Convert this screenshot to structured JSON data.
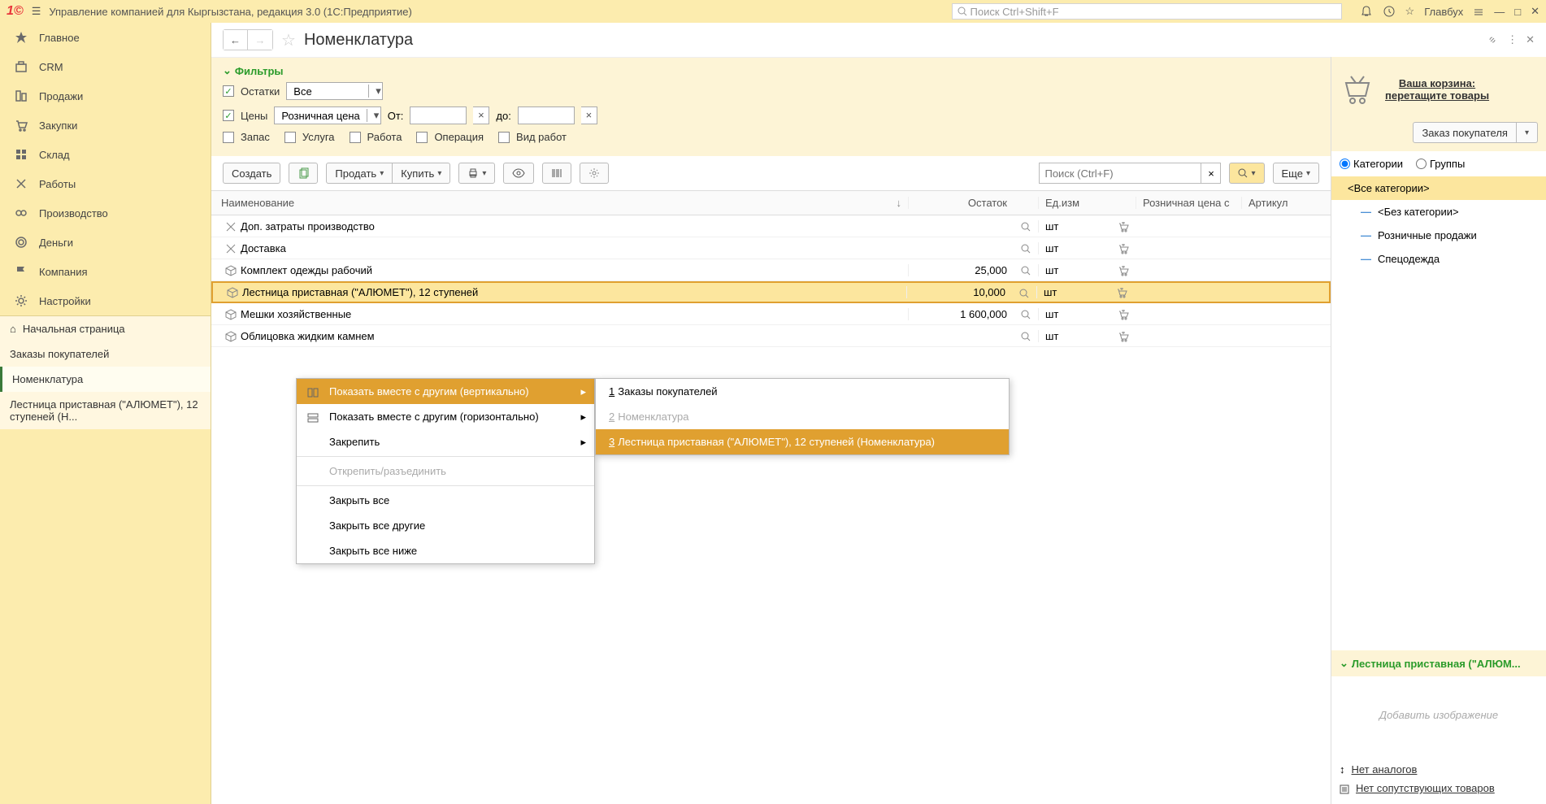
{
  "app": {
    "title": "Управление компанией для Кыргызстана, редакция 3.0  (1С:Предприятие)",
    "search_placeholder": "Поиск Ctrl+Shift+F",
    "user": "Главбух"
  },
  "sidebar": {
    "items": [
      {
        "label": "Главное",
        "icon": "star"
      },
      {
        "label": "CRM",
        "icon": "briefcase"
      },
      {
        "label": "Продажи",
        "icon": "building"
      },
      {
        "label": "Закупки",
        "icon": "cart"
      },
      {
        "label": "Склад",
        "icon": "grid"
      },
      {
        "label": "Работы",
        "icon": "tools"
      },
      {
        "label": "Производство",
        "icon": "gear"
      },
      {
        "label": "Деньги",
        "icon": "coin"
      },
      {
        "label": "Компания",
        "icon": "flag"
      },
      {
        "label": "Настройки",
        "icon": "cog"
      }
    ],
    "secondary": [
      {
        "label": "Начальная страница",
        "icon": "home"
      },
      {
        "label": "Заказы покупателей"
      },
      {
        "label": "Номенклатура",
        "active": true
      },
      {
        "label": "Лестница приставная (\"АЛЮМЕТ\"), 12 ступеней (Н..."
      }
    ]
  },
  "page": {
    "title": "Номенклатура"
  },
  "filters": {
    "title": "Фильтры",
    "balance_label": "Остатки",
    "balance_value": "Все",
    "price_label": "Цены",
    "price_value": "Розничная цена",
    "from_label": "От:",
    "to_label": "до:",
    "checks": [
      "Запас",
      "Услуга",
      "Работа",
      "Операция",
      "Вид работ"
    ]
  },
  "toolbar": {
    "create": "Создать",
    "sell": "Продать",
    "buy": "Купить",
    "more": "Еще",
    "search_placeholder": "Поиск (Ctrl+F)"
  },
  "table": {
    "headers": {
      "name": "Наименование",
      "balance": "Остаток",
      "unit": "Ед.изм",
      "price": "Розничная цена с",
      "article": "Артикул"
    },
    "rows": [
      {
        "icon": "tools",
        "name": "Доп. затраты производство",
        "balance": "",
        "unit": "шт"
      },
      {
        "icon": "tools",
        "name": "Доставка",
        "balance": "",
        "unit": "шт"
      },
      {
        "icon": "box",
        "name": "Комплект одежды рабочий",
        "balance": "25,000",
        "unit": "шт"
      },
      {
        "icon": "box",
        "name": "Лестница приставная (\"АЛЮМЕТ\"), 12 ступеней",
        "balance": "10,000",
        "unit": "шт",
        "selected": true
      },
      {
        "icon": "box",
        "name": "Мешки хозяйственные",
        "balance": "1 600,000",
        "unit": "шт"
      },
      {
        "icon": "box",
        "name": "Облицовка жидким камнем",
        "balance": "",
        "unit": "шт"
      }
    ]
  },
  "rightpanel": {
    "cart_title": "Ваша корзина:",
    "cart_sub": "перетащите товары",
    "order_btn": "Заказ покупателя",
    "radio_cat": "Категории",
    "radio_grp": "Группы",
    "categories": [
      {
        "label": "<Все категории>",
        "selected": true,
        "root": true
      },
      {
        "label": "<Без категории>"
      },
      {
        "label": "Розничные продажи"
      },
      {
        "label": "Спецодежда"
      }
    ],
    "detail_title": "Лестница приставная (\"АЛЮМ...",
    "add_image": "Добавить изображение",
    "no_analog": "Нет аналогов",
    "no_related": "Нет сопутствующих товаров"
  },
  "context_menu": {
    "items": [
      {
        "label": "Показать вместе с другим (вертикально)",
        "icon": "split-v",
        "arrow": true,
        "highlight": true
      },
      {
        "label": "Показать вместе с другим (горизонтально)",
        "icon": "split-h",
        "arrow": true
      },
      {
        "label": "Закрепить",
        "arrow": true
      },
      {
        "sep": true
      },
      {
        "label": "Открепить/разъединить",
        "disabled": true
      },
      {
        "sep": true
      },
      {
        "label": "Закрыть все"
      },
      {
        "label": "Закрыть все другие"
      },
      {
        "label": "Закрыть все ниже"
      }
    ],
    "submenu": [
      {
        "num": "1",
        "label": "Заказы покупателей"
      },
      {
        "num": "2",
        "label": "Номенклатура",
        "disabled": true
      },
      {
        "num": "3",
        "label": "Лестница приставная (\"АЛЮМЕТ\"), 12 ступеней (Номенклатура)",
        "highlight": true
      }
    ]
  }
}
